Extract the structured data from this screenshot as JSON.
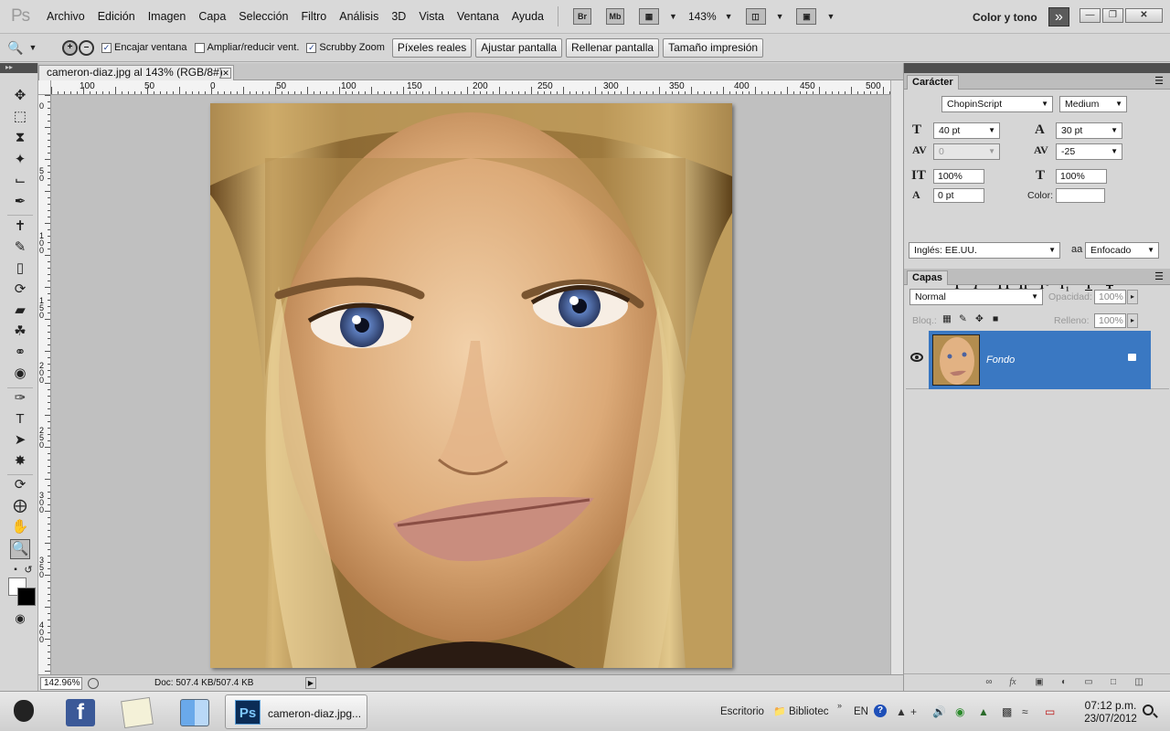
{
  "app": {
    "logo": "Ps",
    "workspace": "Color y tono",
    "zoom": "143%"
  },
  "menu": [
    "Archivo",
    "Edición",
    "Imagen",
    "Capa",
    "Selección",
    "Filtro",
    "Análisis",
    "3D",
    "Vista",
    "Ventana",
    "Ayuda"
  ],
  "menubar_buttons": {
    "bridge": "Br",
    "mini_bridge": "Mb"
  },
  "options": {
    "fit_window": "Encajar ventana",
    "resize_windows": "Ampliar/reducir vent.",
    "scrubby": "Scrubby Zoom",
    "actual_pixels": "Píxeles reales",
    "fit_screen": "Ajustar pantalla",
    "fill_screen": "Rellenar pantalla",
    "print_size": "Tamaño impresión"
  },
  "document": {
    "tab_title": "cameron-diaz.jpg al 143% (RGB/8#)",
    "zoom_field": "142.96%",
    "doc_info": "Doc: 507.4 KB/507.4 KB",
    "ruler_top": [
      "100",
      "50",
      "0",
      "50",
      "100",
      "150",
      "200",
      "250",
      "300",
      "350",
      "400",
      "450",
      "500"
    ],
    "ruler_left": [
      "0",
      "5 0",
      "1 0 0",
      "1 5 0",
      "2 0 0",
      "2 5 0",
      "3 0 0",
      "3 5 0",
      "4 0 0"
    ]
  },
  "character_panel": {
    "tab": "Carácter",
    "font_family": "ChopinScript",
    "font_style": "Medium",
    "size": "40 pt",
    "leading": "30 pt",
    "kerning": "0",
    "tracking": "-25",
    "vscale": "100%",
    "hscale": "100%",
    "baseline": "0 pt",
    "color_label": "Color:",
    "language": "Inglés: EE.UU.",
    "aa_label": "a",
    "antialias": "Enfocado"
  },
  "layers_panel": {
    "tab": "Capas",
    "blend_mode": "Normal",
    "opacity_label": "Opacidad:",
    "opacity": "100%",
    "lock_label": "Bloq.:",
    "fill_label": "Relleno:",
    "fill": "100%",
    "layer_name": "Fondo"
  },
  "taskbar": {
    "ps_label": "cameron-diaz.jpg...",
    "desktop": "Escritorio",
    "library": "Bibliotec",
    "lang": "EN",
    "time": "07:12 p.m.",
    "date": "23/07/2012"
  },
  "colors": {
    "selection_blue": "#3a78c2",
    "panel_gray": "#d6d6d6",
    "facebook_blue": "#3b5998"
  }
}
